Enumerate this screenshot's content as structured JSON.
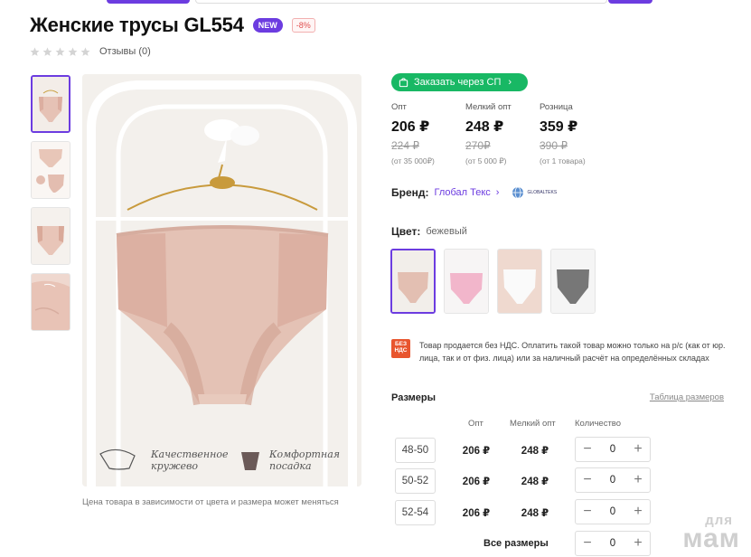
{
  "header": {
    "title": "Женские трусы GL554",
    "badge_new": "NEW",
    "badge_discount": "-8%"
  },
  "rating": {
    "stars_filled": 0,
    "stars_total": 5,
    "reviews_label": "Отзывы (0)"
  },
  "gallery": {
    "thumbnail_count": 4,
    "active_index": 0,
    "main_image_texts": [
      "Качественное кружево",
      "Комфортная посадка"
    ],
    "caption": "Цена товара в зависимости от цвета и размера может меняться"
  },
  "order_button": {
    "label": "Заказать через СП"
  },
  "prices": [
    {
      "label": "Опт",
      "value": "206 ₽",
      "old": "224 ₽",
      "note": "(от 35 000₽)"
    },
    {
      "label": "Мелкий опт",
      "value": "248 ₽",
      "old": "270₽",
      "note": "(от 5 000 ₽)"
    },
    {
      "label": "Розница",
      "value": "359 ₽",
      "old": "390 ₽",
      "note": "(от 1 товара)"
    }
  ],
  "brand": {
    "label": "Бренд:",
    "name": "Глобал Текс",
    "logo_text": "GLOBALTEKS"
  },
  "color": {
    "label": "Цвет:",
    "value": "бежевый",
    "swatches": [
      {
        "name": "beige",
        "color": "#e8c8bc"
      },
      {
        "name": "pink",
        "color": "#f2b6cb"
      },
      {
        "name": "white",
        "color": "#f4f4f4"
      },
      {
        "name": "gray",
        "color": "#7a7a7a"
      }
    ]
  },
  "vat": {
    "icon_text": "БЕЗ НДС",
    "text": "Товар продается без НДС. Оплатить такой товар можно только на р/с (как от юр. лица, так и от физ. лица) или за наличный расчёт на определённых складах"
  },
  "sizes": {
    "title": "Размеры",
    "table_link": "Таблица размеров",
    "columns": {
      "opt": "Опт",
      "small_opt": "Мелкий опт",
      "quantity": "Количество"
    },
    "rows": [
      {
        "size": "48-50",
        "opt": "206 ₽",
        "small_opt": "248 ₽",
        "qty": "0"
      },
      {
        "size": "50-52",
        "opt": "206 ₽",
        "small_opt": "248 ₽",
        "qty": "0"
      },
      {
        "size": "52-54",
        "opt": "206 ₽",
        "small_opt": "248 ₽",
        "qty": "0"
      }
    ],
    "all_sizes": {
      "label": "Все размеры",
      "qty": "0"
    },
    "minus": "−",
    "plus": "+"
  },
  "watermark": {
    "line1": "для",
    "line2": "мам"
  },
  "colors": {
    "accent": "#6c3ce0",
    "order_green": "#18b864",
    "vat_orange": "#e8552e"
  }
}
